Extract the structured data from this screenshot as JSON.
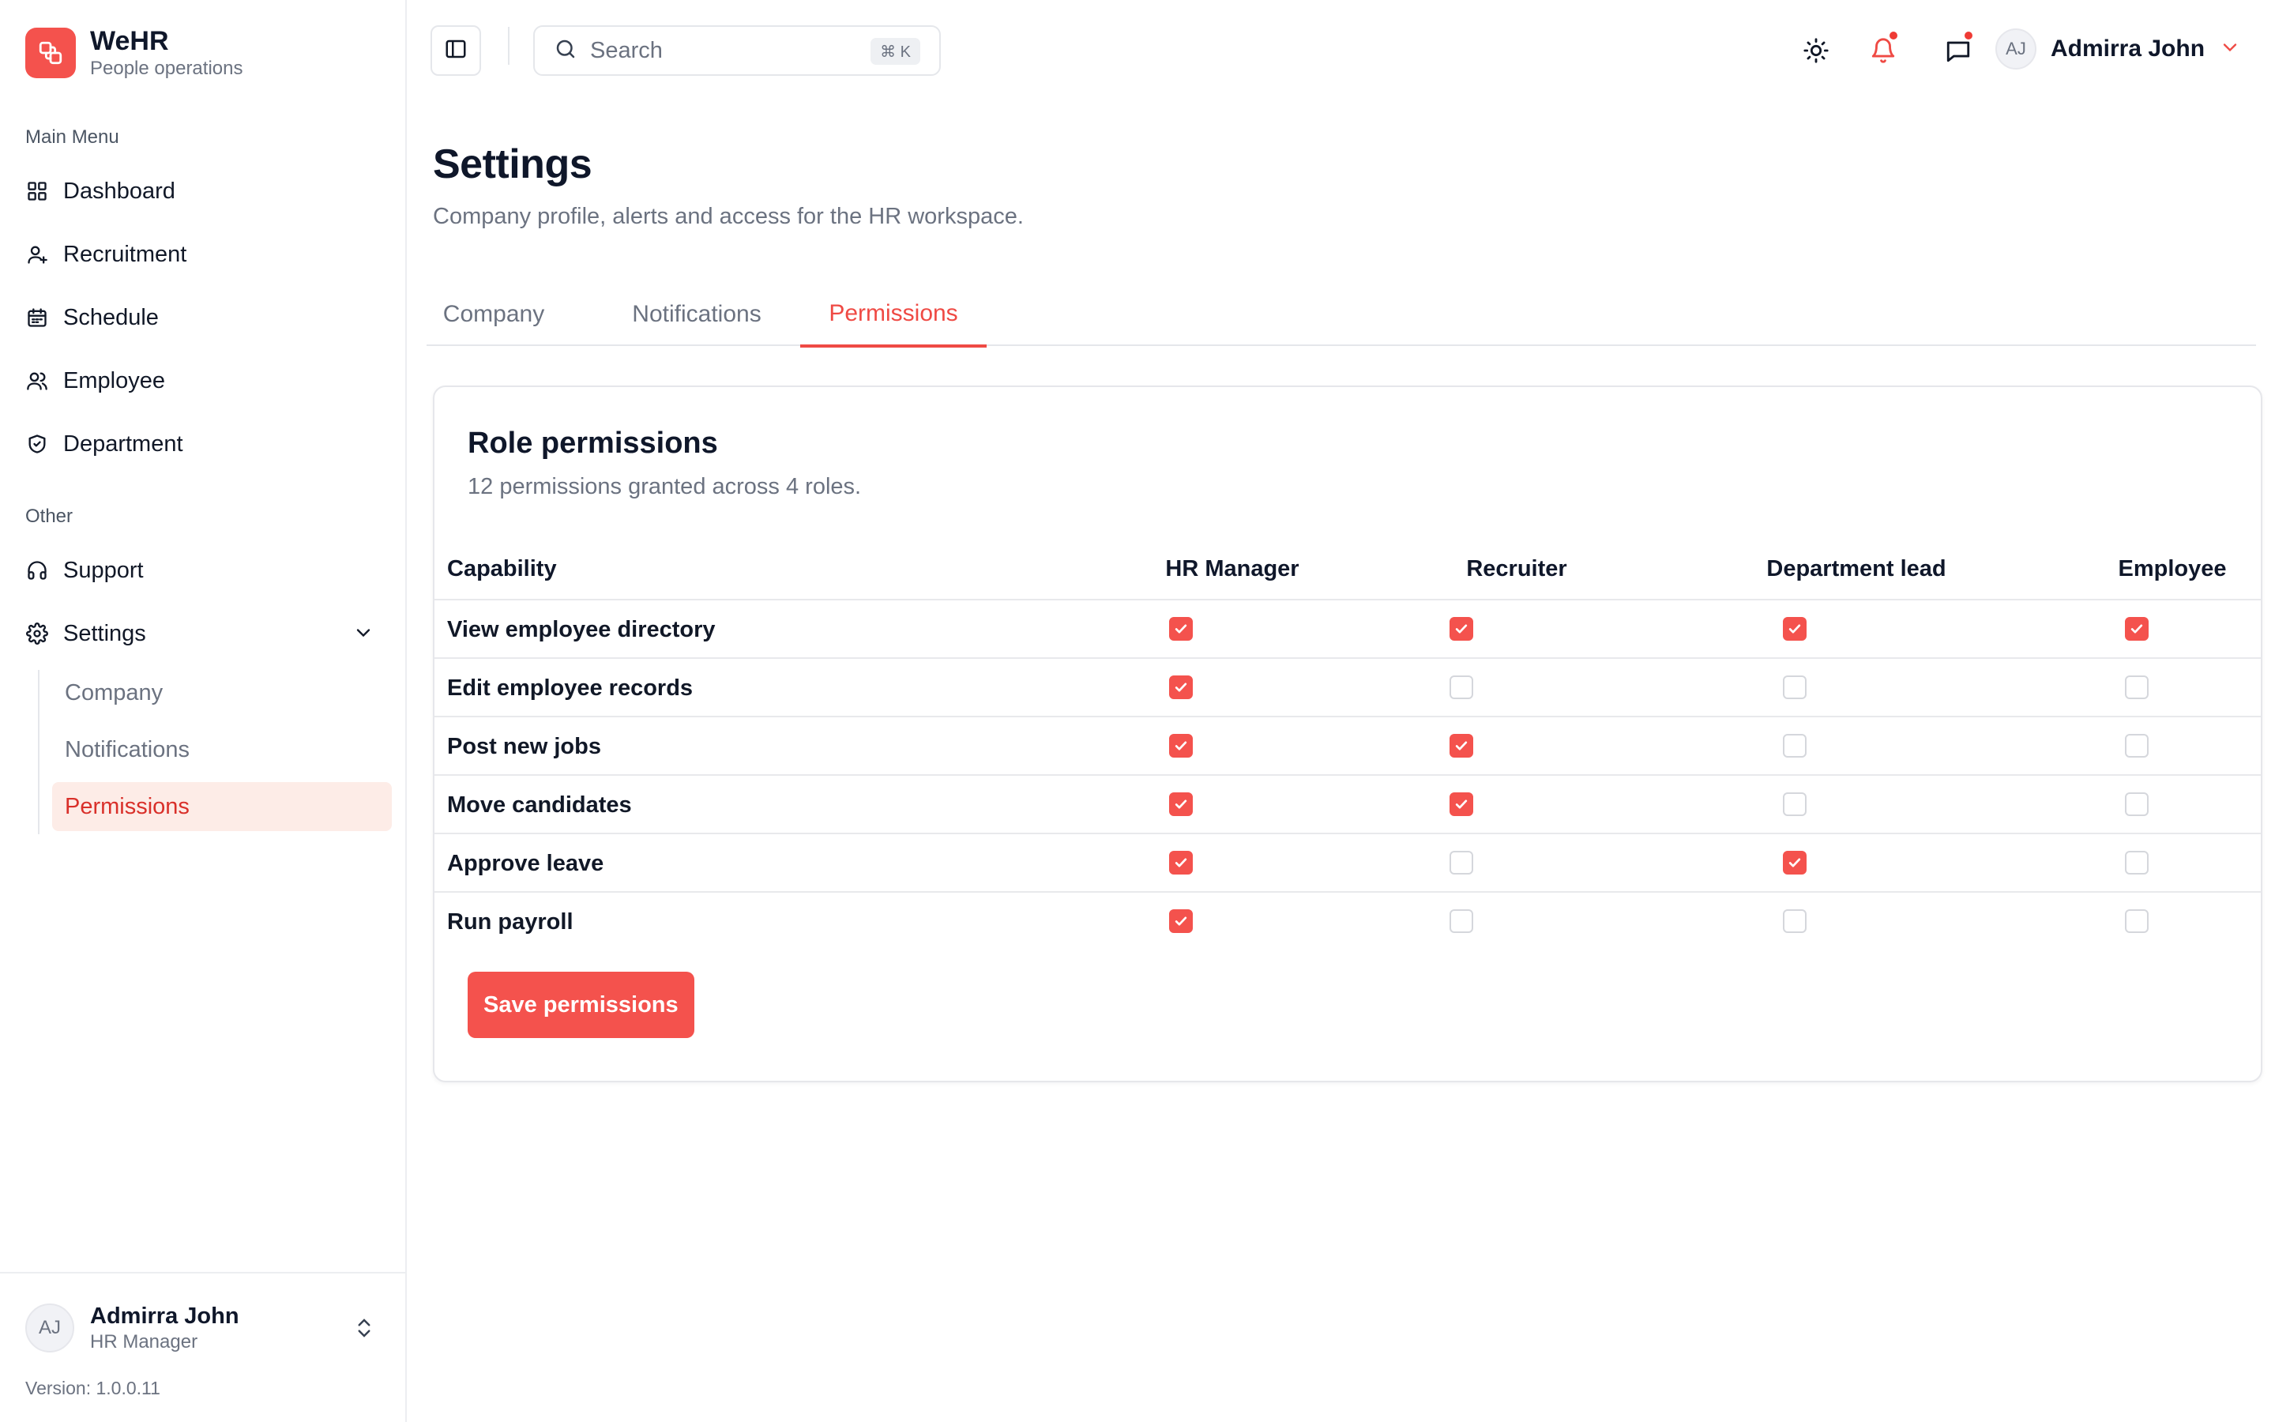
{
  "brand": {
    "name": "WeHR",
    "subtitle": "People operations"
  },
  "sidebar": {
    "main_menu_label": "Main Menu",
    "main_items": [
      {
        "label": "Dashboard",
        "icon": "grid-icon"
      },
      {
        "label": "Recruitment",
        "icon": "user-plus-icon"
      },
      {
        "label": "Schedule",
        "icon": "calendar-icon"
      },
      {
        "label": "Employee",
        "icon": "users-icon"
      },
      {
        "label": "Department",
        "icon": "shield-icon"
      }
    ],
    "other_label": "Other",
    "other_items": [
      {
        "label": "Support",
        "icon": "headphones-icon"
      },
      {
        "label": "Settings",
        "icon": "gear-icon",
        "expanded": true
      }
    ],
    "settings_sub": [
      {
        "label": "Company",
        "active": false
      },
      {
        "label": "Notifications",
        "active": false
      },
      {
        "label": "Permissions",
        "active": true
      }
    ],
    "footer": {
      "name": "Admirra John",
      "role": "HR Manager",
      "initials": "AJ",
      "version": "Version: 1.0.0.11"
    }
  },
  "topbar": {
    "search_placeholder": "Search",
    "search_shortcut": "⌘ K",
    "user_initials": "AJ",
    "user_name": "Admirra John",
    "notifications_unread": true,
    "messages_unread": true
  },
  "page": {
    "title": "Settings",
    "subtitle": "Company profile, alerts and access for the HR workspace.",
    "tabs": [
      {
        "label": "Company",
        "active": false
      },
      {
        "label": "Notifications",
        "active": false
      },
      {
        "label": "Permissions",
        "active": true
      }
    ]
  },
  "permissions": {
    "title": "Role permissions",
    "summary": "12 permissions granted across 4 roles.",
    "capability_header": "Capability",
    "roles": [
      "HR Manager",
      "Recruiter",
      "Department lead",
      "Employee"
    ],
    "rows": [
      {
        "capability": "View employee directory",
        "grants": [
          true,
          true,
          true,
          true
        ]
      },
      {
        "capability": "Edit employee records",
        "grants": [
          true,
          false,
          false,
          false
        ]
      },
      {
        "capability": "Post new jobs",
        "grants": [
          true,
          true,
          false,
          false
        ]
      },
      {
        "capability": "Move candidates",
        "grants": [
          true,
          true,
          false,
          false
        ]
      },
      {
        "capability": "Approve leave",
        "grants": [
          true,
          false,
          true,
          false
        ]
      },
      {
        "capability": "Run payroll",
        "grants": [
          true,
          false,
          false,
          false
        ]
      }
    ],
    "save_label": "Save permissions"
  },
  "colors": {
    "accent": "#f4524d",
    "accent_text": "#ef4a44",
    "active_bg": "#fdece7",
    "muted": "#6b7280"
  }
}
